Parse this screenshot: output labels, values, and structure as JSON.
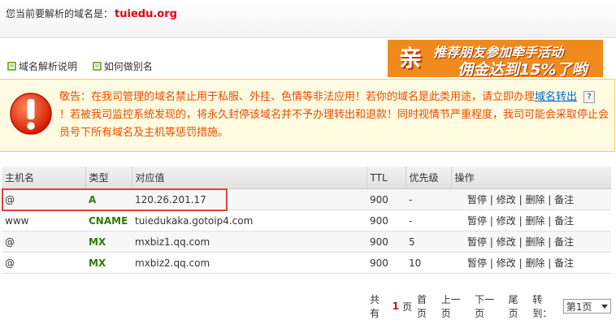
{
  "header": {
    "domain_prefix": "您当前要解析的域名是：",
    "domain_name": "tuiedu.org"
  },
  "help_links": [
    {
      "label": "域名解析说明",
      "icon": "help-doc-icon"
    },
    {
      "label": "如何做别名",
      "icon": "help-doc-icon"
    }
  ],
  "banner": {
    "badge": "亲",
    "line1": "推荐朋友参加牵手活动",
    "line2": "佣金达到15%了哟"
  },
  "warning": {
    "text1": "敬告：在我司管理的域名禁止用于私服、外挂、色情等非法应用！若你的域名是此类用途，请立即办理",
    "link": "域名转出",
    "help_mark": "?",
    "text2": "！若被我司监控系统发现的，将永久封停该域名并不予办理转出和退款！同时视情节严重程度，我司可能会采取停止会员号下所有域名及主机等惩罚措施。"
  },
  "table": {
    "headers": [
      "主机名",
      "类型",
      "对应值",
      "TTL",
      "优先级",
      "操作"
    ],
    "rows": [
      {
        "host": "@",
        "type": "A",
        "value": "120.26.201.17",
        "ttl": "900",
        "priority": "-"
      },
      {
        "host": "www",
        "type": "CNAME",
        "value": "tuiedukaka.gotoip4.com",
        "ttl": "900",
        "priority": "-"
      },
      {
        "host": "@",
        "type": "MX",
        "value": "mxbiz1.qq.com",
        "ttl": "900",
        "priority": "5"
      },
      {
        "host": "@",
        "type": "MX",
        "value": "mxbiz2.qq.com",
        "ttl": "900",
        "priority": "10"
      }
    ],
    "actions": {
      "pause": "暂停",
      "edit": "修改",
      "delete": "删除",
      "note": "备注",
      "sep": "|"
    }
  },
  "pager": {
    "total_prefix": "共有",
    "total": "1",
    "total_suffix": "页",
    "first": "首页",
    "prev": "上一页",
    "next": "下一页",
    "last": "尾页",
    "goto": "转到：",
    "selected": "第1页"
  },
  "colors": {
    "accent_red": "#e60012",
    "warning_orange": "#e64d00",
    "type_green": "#2e7d00",
    "link_blue": "#0066cc"
  }
}
